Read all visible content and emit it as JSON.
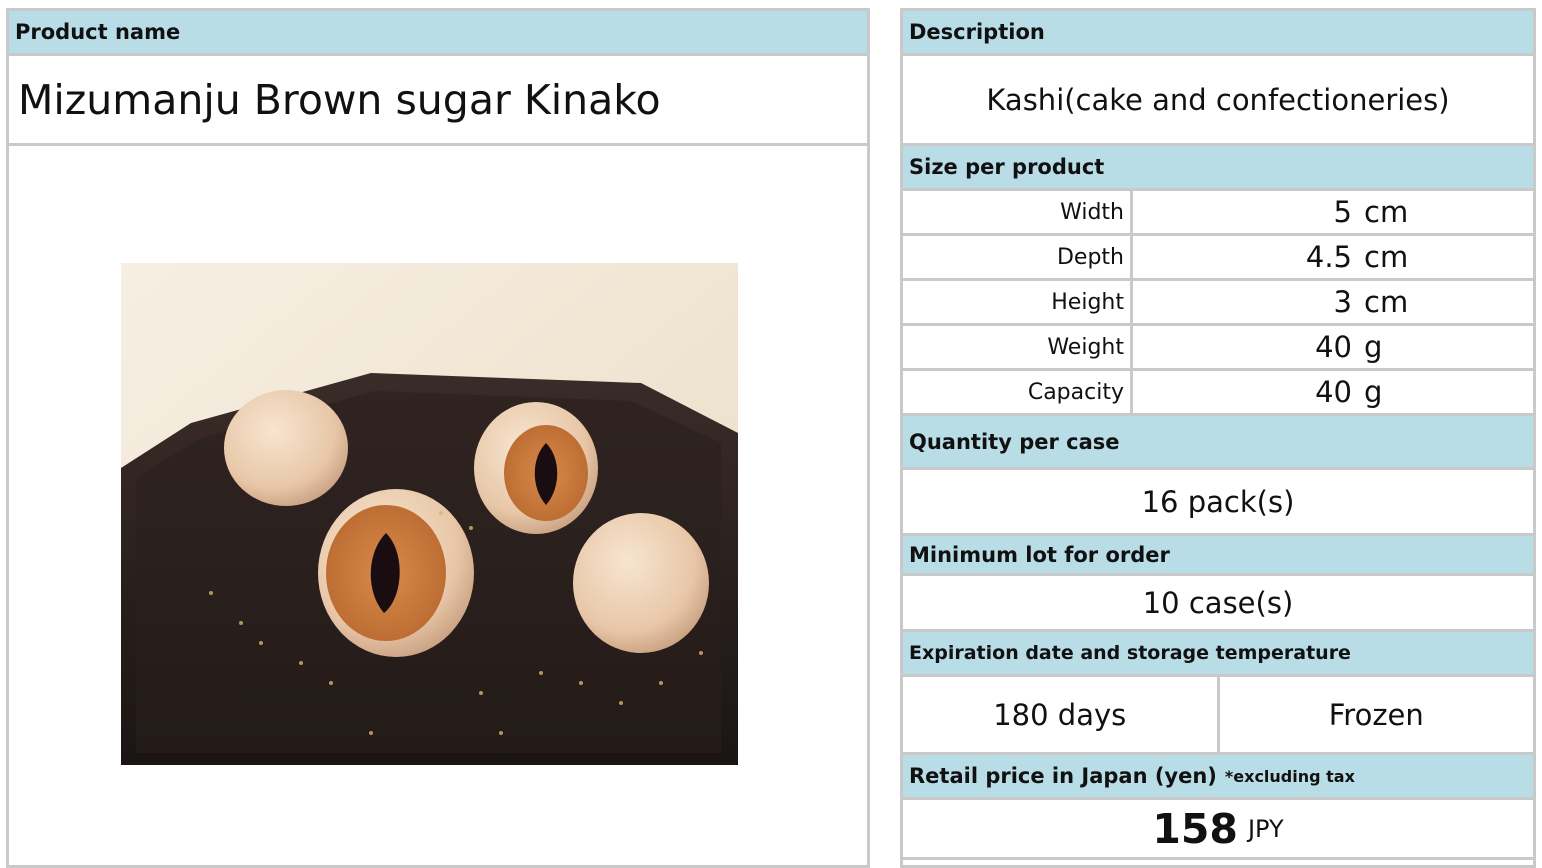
{
  "left": {
    "product_name_header": "Product name",
    "product_name": "Mizumanju Brown sugar Kinako"
  },
  "right": {
    "description_header": "Description",
    "description": "Kashi(cake and confectioneries)",
    "size_header": "Size per product",
    "size": [
      {
        "label": "Width",
        "value": "5",
        "unit": "cm"
      },
      {
        "label": "Depth",
        "value": "4.5",
        "unit": "cm"
      },
      {
        "label": "Height",
        "value": "3",
        "unit": "cm"
      },
      {
        "label": "Weight",
        "value": "40",
        "unit": "g"
      },
      {
        "label": "Capacity",
        "value": "40",
        "unit": "g"
      }
    ],
    "quantity_header": "Quantity per case",
    "quantity": "16 pack(s)",
    "min_lot_header": "Minimum lot for order",
    "min_lot": "10 case(s)",
    "expiration_header": "Expiration date and storage temperature",
    "expiration_days": "180 days",
    "storage": "Frozen",
    "price_header": "Retail price in Japan (yen)",
    "price_note": "*excluding tax",
    "price": "158",
    "currency": "JPY"
  },
  "colors": {
    "header_bg": "#b9dde7",
    "border": "#c9c9c9"
  }
}
